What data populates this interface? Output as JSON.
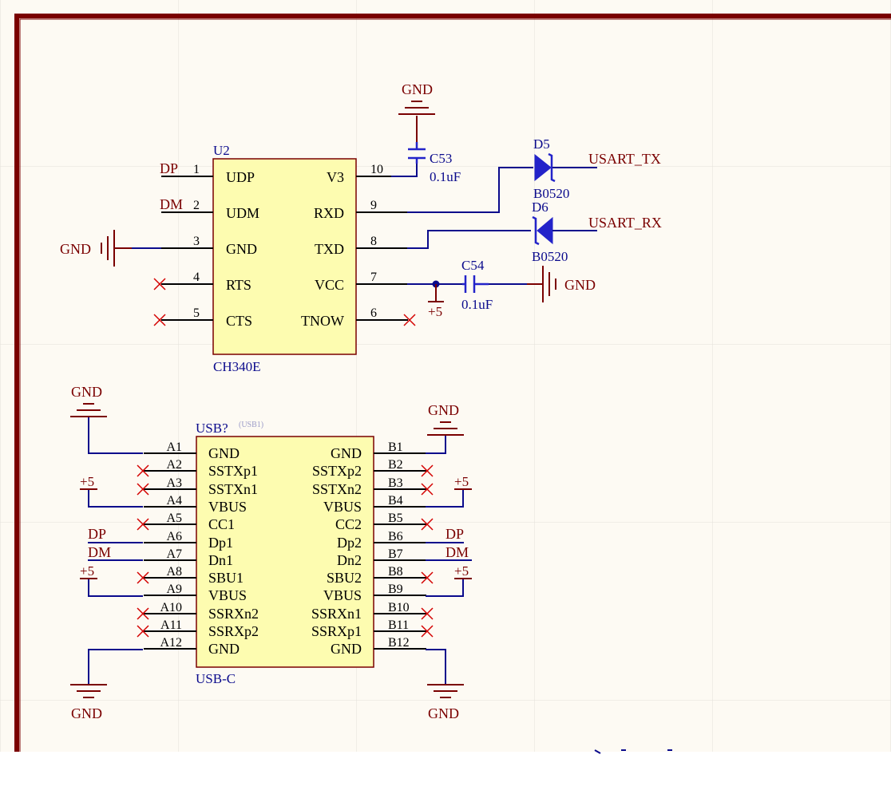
{
  "colors": {
    "sheet_bg": "#fdfaf3",
    "grid": "#e2e0da",
    "border": "#7a0000",
    "wire": "#0a0a8c",
    "pin": "#000000",
    "net": "#7a0000",
    "designator": "#0a0a8c",
    "body_fill": "#fdfcb0",
    "body_stroke": "#7a0000",
    "noconnect": "#d40000",
    "diode": "#2323c9"
  },
  "u2": {
    "designator": "U2",
    "comment": "CH340E",
    "left_pins": [
      {
        "num": "1",
        "name": "UDP"
      },
      {
        "num": "2",
        "name": "UDM"
      },
      {
        "num": "3",
        "name": "GND"
      },
      {
        "num": "4",
        "name": "RTS"
      },
      {
        "num": "5",
        "name": "CTS"
      }
    ],
    "right_pins": [
      {
        "num": "10",
        "name": "V3"
      },
      {
        "num": "9",
        "name": "RXD"
      },
      {
        "num": "8",
        "name": "TXD"
      },
      {
        "num": "7",
        "name": "VCC"
      },
      {
        "num": "6",
        "name": "TNOW"
      }
    ]
  },
  "c53": {
    "designator": "C53",
    "value": "0.1uF"
  },
  "c54": {
    "designator": "C54",
    "value": "0.1uF"
  },
  "d5": {
    "designator": "D5",
    "part": "B0520"
  },
  "d6": {
    "designator": "D6",
    "part": "B0520"
  },
  "nets": {
    "dp": "DP",
    "dm": "DM",
    "gnd": "GND",
    "vplus": "+5",
    "usart_tx": "USART_TX",
    "usart_rx": "USART_RX",
    "dp_usb": "DP",
    "dm_usb": "DM"
  },
  "usb": {
    "designator": "USB?",
    "hint": "(USB1)",
    "comment": "USB-C",
    "left_pins": [
      {
        "num": "A1",
        "name": "GND"
      },
      {
        "num": "A2",
        "name": "SSTXp1"
      },
      {
        "num": "A3",
        "name": "SSTXn1"
      },
      {
        "num": "A4",
        "name": "VBUS"
      },
      {
        "num": "A5",
        "name": "CC1"
      },
      {
        "num": "A6",
        "name": "Dp1"
      },
      {
        "num": "A7",
        "name": "Dn1"
      },
      {
        "num": "A8",
        "name": "SBU1"
      },
      {
        "num": "A9",
        "name": "VBUS"
      },
      {
        "num": "A10",
        "name": "SSRXn2"
      },
      {
        "num": "A11",
        "name": "SSRXp2"
      },
      {
        "num": "A12",
        "name": "GND"
      }
    ],
    "right_pins": [
      {
        "num": "B1",
        "name": "GND"
      },
      {
        "num": "B2",
        "name": "SSTXp2"
      },
      {
        "num": "B3",
        "name": "SSTXn2"
      },
      {
        "num": "B4",
        "name": "VBUS"
      },
      {
        "num": "B5",
        "name": "CC2"
      },
      {
        "num": "B6",
        "name": "Dp2"
      },
      {
        "num": "B7",
        "name": "Dn2"
      },
      {
        "num": "B8",
        "name": "SBU2"
      },
      {
        "num": "B9",
        "name": "VBUS"
      },
      {
        "num": "B10",
        "name": "SSRXn1"
      },
      {
        "num": "B11",
        "name": "SSRXp1"
      },
      {
        "num": "B12",
        "name": "GND"
      }
    ]
  }
}
